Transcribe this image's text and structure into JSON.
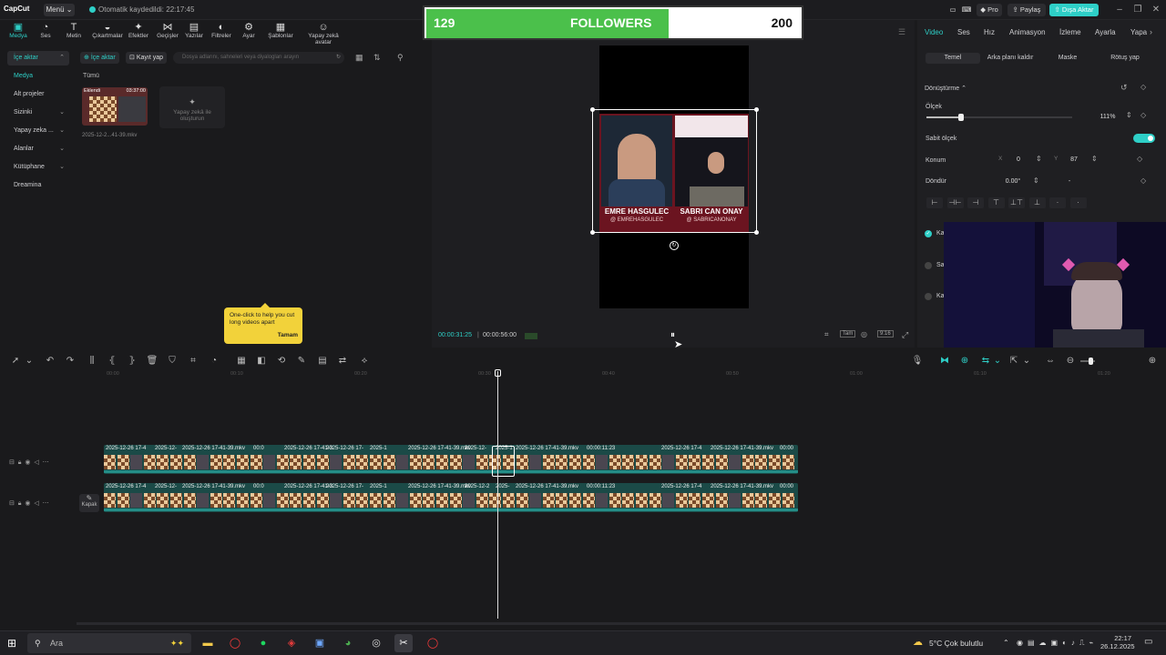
{
  "app": {
    "logo": "CapCut",
    "menu_label": "Menü",
    "autosave": "Otomatik kaydedildi: 22:17:45",
    "pro_label": "Pro",
    "share_label": "Paylaş",
    "export_label": "Dışa Aktar"
  },
  "toolbar": {
    "items": [
      {
        "label": "Medya",
        "icon": "media-icon"
      },
      {
        "label": "Ses",
        "icon": "audio-icon"
      },
      {
        "label": "Metin",
        "icon": "text-icon"
      },
      {
        "label": "Çıkartmalar",
        "icon": "sticker-icon"
      },
      {
        "label": "Efektler",
        "icon": "effects-icon"
      },
      {
        "label": "Geçişler",
        "icon": "transitions-icon"
      },
      {
        "label": "Yazılar",
        "icon": "captions-icon"
      },
      {
        "label": "Filtreler",
        "icon": "filters-icon"
      },
      {
        "label": "Ayar",
        "icon": "adjust-icon"
      },
      {
        "label": "Şablonlar",
        "icon": "templates-icon"
      },
      {
        "label": "Yapay zekâ avatar",
        "icon": "ai-avatar-icon"
      }
    ]
  },
  "leftnav": {
    "items": [
      {
        "label": "İçe aktar",
        "chev": "⌃"
      },
      {
        "label": "Medya",
        "chev": ""
      },
      {
        "label": "Alt projeler",
        "chev": ""
      },
      {
        "label": "Sizinki",
        "chev": "⌄"
      },
      {
        "label": "Yapay zeka ...",
        "chev": "⌄"
      },
      {
        "label": "Alanlar",
        "chev": "⌄"
      },
      {
        "label": "Kütüphane",
        "chev": "⌄"
      },
      {
        "label": "Dreamina",
        "chev": ""
      }
    ]
  },
  "media": {
    "import_btn": "İçe aktar",
    "record_btn": "Kayıt yap",
    "search_placeholder": "Dosya adlarını, sahneleri veya diyalogları arayın",
    "filter_all": "Tümü",
    "clip": {
      "badge": "Eklendi",
      "duration": "03:37:00",
      "name": "2025-12-2...41-39.mkv"
    },
    "ai_card": "Yapay zekâ ile oluşturun"
  },
  "tooltip": {
    "text": "One-click to help you cut long videos apart",
    "ok": "Tamam"
  },
  "preview": {
    "current_time": "00:00:31:25",
    "total_time": "00:00:56:00",
    "names": [
      "EMRE HASGULEC",
      "SABRI CAN ONAY"
    ],
    "handles": [
      "@ EMREHASGULEC",
      "@ SABRICANONAY"
    ],
    "ratio_label": "9:16",
    "full_label": "Tam"
  },
  "followers": {
    "current": "129",
    "label": "FOLLOWERS",
    "goal": "200",
    "progress": 0.645
  },
  "right_panel": {
    "tabs": [
      "Video",
      "Ses",
      "Hız",
      "Animasyon",
      "İzleme",
      "Ayarla",
      "Yapa"
    ],
    "subtabs": [
      "Temel",
      "Arka planı kaldır",
      "Maske",
      "Rötuş yap"
    ],
    "section": "Dönüştürme",
    "scale_label": "Ölçek",
    "scale_value": "111%",
    "uniform_label": "Sabit ölçek",
    "position_label": "Konum",
    "pos_x_label": "X",
    "pos_x": "0",
    "pos_y_label": "Y",
    "pos_y": "87",
    "rotate_label": "Döndür",
    "rotate_value": "0.00°",
    "rotate_dash": "-",
    "checks": [
      "Ka",
      "Sa",
      "Ka"
    ]
  },
  "timeline": {
    "ruler": [
      "00:00",
      "00:10",
      "00:20",
      "00:30",
      "00:40",
      "00:50",
      "01:00",
      "01:10",
      "01:20"
    ],
    "track1_names": [
      "2025-12-26 17-4",
      "2025-12-",
      "2025-12-26 17-41-39.mkv",
      "00:0",
      "2025-12-26 17-41-3",
      "2025-12-26 17-",
      "2025-1",
      "2025-12-26 17-41-39.mkv",
      "2025-12-",
      "2025-1",
      "2025-12-26 17-41-39.mkv",
      "00:00:11:23",
      "2025-12-26 17-4",
      "2025-12-26 17-41-39.mkv",
      "00:00"
    ],
    "track2_names": [
      "2025-12-26 17-4",
      "2025-12-",
      "2025-12-26 17-41-39.mkv",
      "00:0",
      "2025-12-26 17-41-3",
      "2025-12-26 17-",
      "2025-1",
      "2025-12-26 17-41-39.mkv",
      "2025-12-2",
      "2025-",
      "2025-12-26 17-41-39.mkv",
      "00:00:11:23",
      "2025-12-26 17-4",
      "2025-12-26 17-41-39.mkv",
      "00:00"
    ],
    "cover_label": "Kapak"
  },
  "taskbar": {
    "search": "Ara",
    "weather": "5°C  Çok bulutlu",
    "time": "22:17",
    "date": "26.12.2025"
  }
}
